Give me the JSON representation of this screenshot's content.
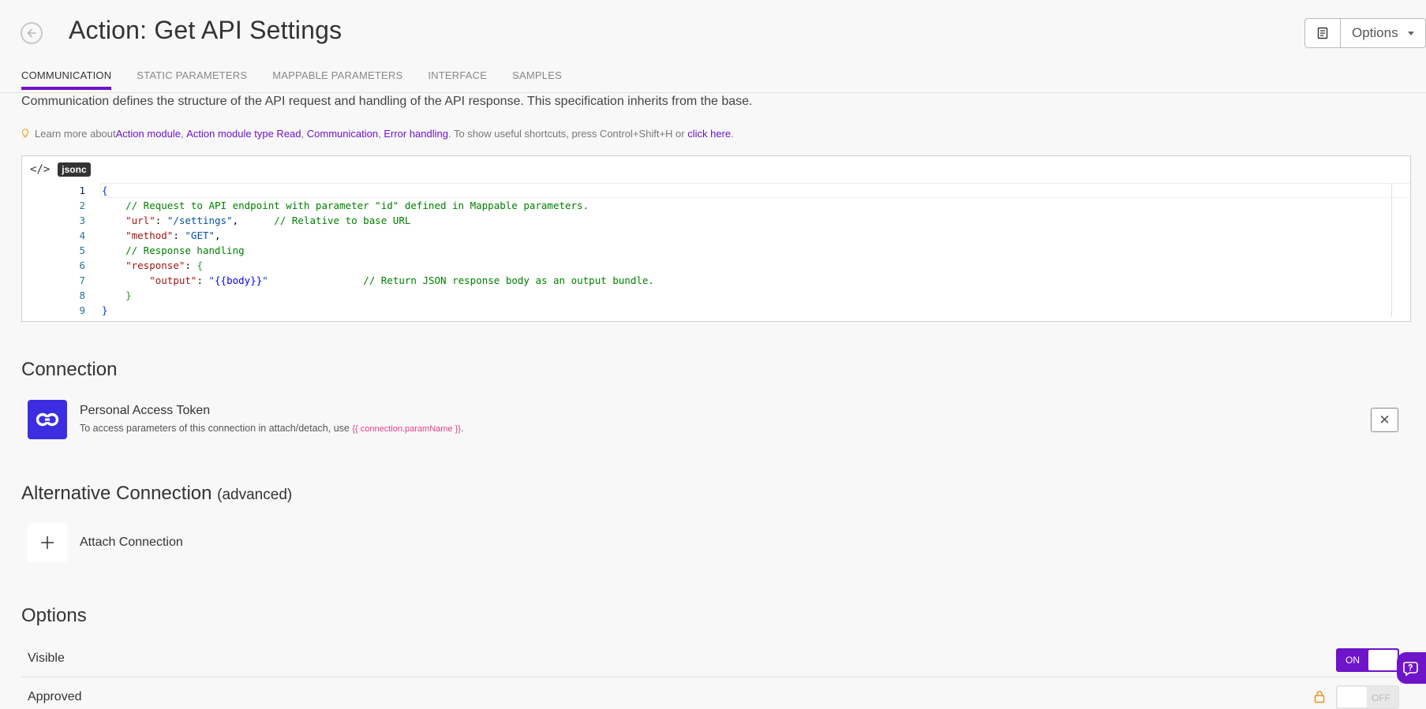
{
  "header": {
    "title": "Action: Get API Settings",
    "options_label": "Options"
  },
  "tabs": [
    {
      "label": "COMMUNICATION",
      "active": true
    },
    {
      "label": "STATIC PARAMETERS",
      "active": false
    },
    {
      "label": "MAPPABLE PARAMETERS",
      "active": false
    },
    {
      "label": "INTERFACE",
      "active": false
    },
    {
      "label": "SAMPLES",
      "active": false
    }
  ],
  "description": "Communication defines the structure of the API request and handling of the API response. This specification inherits from the base.",
  "learn_more": {
    "prefix": "Learn more about ",
    "links": [
      "Action module",
      "Action module type Read",
      "Communication",
      "Error handling"
    ],
    "shortcut_text": ". To show useful shortcuts, press Control+Shift+H or ",
    "click_here": "click here",
    "suffix": "."
  },
  "editor": {
    "language": "jsonc",
    "lines": [
      {
        "n": "1",
        "html": "<span class=\"c-brace\">{</span>"
      },
      {
        "n": "2",
        "html": "    <span class=\"c-cmt\">// Request to API endpoint with parameter \"id\" defined in Mappable parameters.</span>"
      },
      {
        "n": "3",
        "html": "    <span class=\"c-key\">\"url\"</span>: <span class=\"c-str\">\"/settings\"</span>,      <span class=\"c-cmt\">// Relative to base URL</span>"
      },
      {
        "n": "4",
        "html": "    <span class=\"c-key\">\"method\"</span>: <span class=\"c-str\">\"GET\"</span>,"
      },
      {
        "n": "5",
        "html": "    <span class=\"c-cmt\">// Response handling</span>"
      },
      {
        "n": "6",
        "html": "    <span class=\"c-key\">\"response\"</span>: <span class=\"c-brace2\">{</span>"
      },
      {
        "n": "7",
        "html": "        <span class=\"c-key\">\"output\"</span>: <span class=\"c-str\">\"</span><span class=\"c-mus\">{{body}}</span><span class=\"c-str\">\"</span>                <span class=\"c-cmt\">// Return JSON response body as an output bundle.</span>"
      },
      {
        "n": "8",
        "html": "    <span class=\"c-brace2\">}</span>"
      },
      {
        "n": "9",
        "html": "<span class=\"c-brace\">}</span>"
      }
    ]
  },
  "connection": {
    "section_title": "Connection",
    "name": "Personal Access Token",
    "note_prefix": "To access parameters of this connection in attach/detach, use ",
    "note_code": "{{ connection.paramName }}",
    "note_suffix": "."
  },
  "alt_connection": {
    "section_title": "Alternative Connection",
    "section_suffix": "(advanced)",
    "attach_label": "Attach Connection"
  },
  "options": {
    "section_title": "Options",
    "rows": [
      {
        "label": "Visible",
        "state": "ON"
      },
      {
        "label": "Approved",
        "state": "OFF"
      }
    ]
  },
  "colors": {
    "accent": "#6e14c9",
    "connection_icon_bg": "#3c2ee0"
  }
}
